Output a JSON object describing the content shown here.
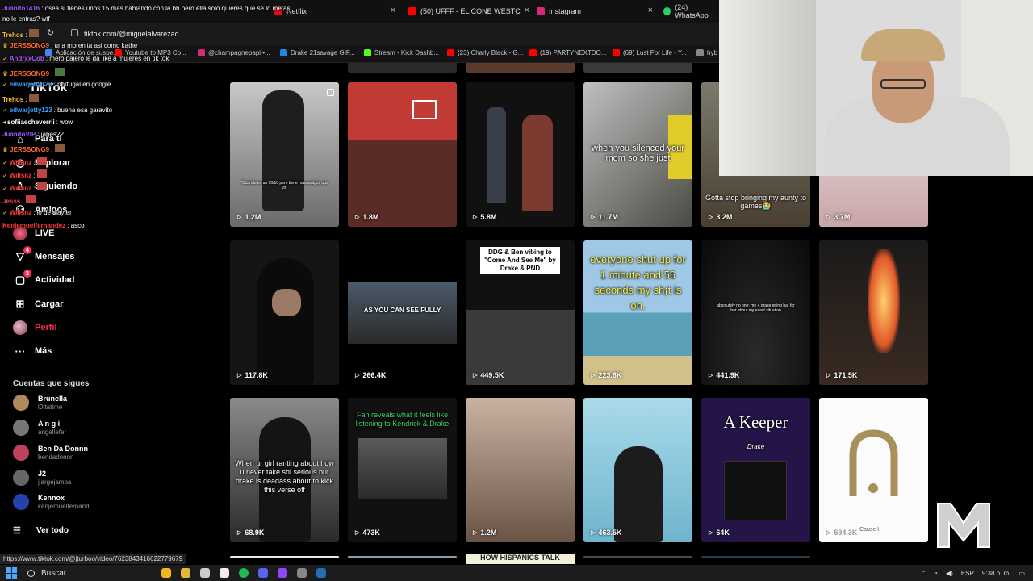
{
  "browser": {
    "tabs": [
      {
        "label": "Netflix",
        "icon": "netflix-icon",
        "color": "#e50914"
      },
      {
        "label": "(50) UFFF - EL CONE",
        "icon": "youtube-icon",
        "color": "#ff0000"
      },
      {
        "label": "WESTC",
        "icon": "youtube-icon",
        "color": "#ff0000"
      },
      {
        "label": "Instagram",
        "icon": "instagram-icon",
        "color": "#d62976"
      },
      {
        "label": "(24) WhatsApp",
        "icon": "whatsapp-icon",
        "color": "#25d366"
      }
    ],
    "url": "tiktok.com/@miguelalvarezac",
    "bookmarks": [
      {
        "label": "Aplicación de suspe...",
        "color": "#4285f4"
      },
      {
        "label": "Youtube to MP3 Co...",
        "color": "#ff0000"
      },
      {
        "label": "@champagnepapi •...",
        "color": "#d62976"
      },
      {
        "label": "Drake 21savage GIF...",
        "color": "#1e88e5"
      },
      {
        "label": "Stream - Kick Dashb...",
        "color": "#53fc18"
      },
      {
        "label": "(23) Charly Black - G...",
        "color": "#ff0000"
      },
      {
        "label": "(19) PARTYNEXTDO...",
        "color": "#ff0000"
      },
      {
        "label": "(69) Lust For Life - Y...",
        "color": "#ff0000"
      },
      {
        "label": "hyb",
        "color": "#888888"
      }
    ]
  },
  "sidebar": {
    "logo": "TikTok",
    "nav": [
      {
        "label": "Para ti",
        "icon": "home-icon"
      },
      {
        "label": "Explorar",
        "icon": "compass-icon"
      },
      {
        "label": "Siguiendo",
        "icon": "following-icon"
      },
      {
        "label": "Amigos",
        "icon": "friends-icon"
      },
      {
        "label": "LIVE",
        "icon": "live-icon"
      },
      {
        "label": "Mensajes",
        "icon": "messages-icon",
        "badge": "4"
      },
      {
        "label": "Actividad",
        "icon": "activity-icon",
        "badge": "2"
      },
      {
        "label": "Cargar",
        "icon": "upload-icon"
      },
      {
        "label": "Perfil",
        "icon": "profile-icon"
      },
      {
        "label": "Más",
        "icon": "more-icon"
      }
    ],
    "following_title": "Cuentas que sigues",
    "following": [
      {
        "name": "Brunella",
        "handle": "l0ttatime",
        "color": "#b08a5a"
      },
      {
        "name": "A n g i",
        "handle": "angellefer",
        "color": "#777777"
      },
      {
        "name": "Ben Da Donnn",
        "handle": "bendadonnn",
        "color": "#c04060"
      },
      {
        "name": "J2",
        "handle": "jlargejamba",
        "color": "#666666"
      },
      {
        "name": "Kennox",
        "handle": "kenjemuelfernand",
        "color": "#2244aa"
      }
    ],
    "see_all": "Ver todo"
  },
  "chat": [
    {
      "user": "Juanito1416",
      "color": "#9b59ff",
      "text": "osea si tienes unos 15 días hablando con la bb pero ella solo quieres que se lo metas",
      "cont": "no le entras? wtf"
    },
    {
      "user": "Trehos",
      "color": "#f4c430",
      "text": ""
    },
    {
      "user": "JERSSONG9",
      "color": "#ff6a2a",
      "text": "una morenita asi como kathe"
    },
    {
      "user": "AndrxxCob",
      "color": "#b05cff",
      "text": "mero pajero le da like a mujeres en tik tok"
    },
    {
      "user": "JERSSONG9",
      "color": "#ff6a2a",
      "text": ""
    },
    {
      "user": "edwarjetty123",
      "color": "#3aa0ff",
      "text": "portugal en google"
    },
    {
      "user": "Trehos",
      "color": "#f4c430",
      "text": ""
    },
    {
      "user": "edwarjetty123",
      "color": "#3aa0ff",
      "text": "buena esa garavito"
    },
    {
      "user": "sofiiaecheverrii",
      "color": "#ffffff",
      "text": "wow"
    },
    {
      "user": "JuanitoVIP",
      "color": "#9b59ff",
      "text": "jabes??"
    },
    {
      "user": "JERSSONG9",
      "color": "#ff6a2a",
      "text": ""
    },
    {
      "user": "Willsnz",
      "color": "#ff3b3b",
      "text": ""
    },
    {
      "user": "Willsnz",
      "color": "#ff3b3b",
      "text": ""
    },
    {
      "user": "Willsnz",
      "color": "#ff3b3b",
      "text": ""
    },
    {
      "user": "Jesss",
      "color": "#ff3b3b",
      "text": ""
    },
    {
      "user": "Willsnz",
      "color": "#ff3b3b",
      "text": "lo de slayter"
    },
    {
      "user": "Kenjemuelfernandez",
      "color": "#ff3b3b",
      "text": "asco"
    }
  ],
  "grid": [
    {
      "views": "1.2M",
      "caption": "\"Cuando es un 10/10 pero tiene más amigos que yo\"",
      "bg": "#9a9a9a"
    },
    {
      "views": "1.8M",
      "caption": "",
      "bg": "#b3342f"
    },
    {
      "views": "5.8M",
      "caption": "",
      "bg": "#1b1b1b"
    },
    {
      "views": "11.7M",
      "caption": "when you silenced your mom so she just",
      "bg": "#8a8a80"
    },
    {
      "views": "3.2M",
      "caption": "Gotta stop bringing my aunty to games😭",
      "bg": "#6a6252"
    },
    {
      "views": "3.7M",
      "caption": "",
      "bg": "#d8c2c4"
    },
    {
      "views": "117.8K",
      "caption": "",
      "bg": "#161616"
    },
    {
      "views": "266.4K",
      "caption": "AS YOU CAN SEE FULLY",
      "bg": "#0a0a0a"
    },
    {
      "views": "449.5K",
      "caption": "DDG & Ben vibing to \"Come And See Me\" by Drake & PND",
      "bg": "#2a2a2a"
    },
    {
      "views": "223.6K",
      "caption": "everyone shut up for 1 minute and 56 seconds my sh¡t is on.",
      "bg": "#6fa7c8"
    },
    {
      "views": "441.9K",
      "caption": "absolutely no one: me + drake going bar for bar about my exact situation",
      "bg": "#141414"
    },
    {
      "views": "171.5K",
      "caption": "",
      "bg": "#3a2a1c"
    },
    {
      "views": "68.9K",
      "caption": "When ur girl ranting about how u never take shi serious but drake is deadass about to kick this verse off",
      "bg": "#4a4a4a"
    },
    {
      "views": "473K",
      "caption": "Fan reveals what it feels like listening to Kendrick & Drake",
      "bg": "#111111"
    },
    {
      "views": "1.2M",
      "caption": "",
      "bg": "#9a7e6c"
    },
    {
      "views": "463.5K",
      "caption": "",
      "bg": "#8fc4d8"
    },
    {
      "views": "64K",
      "caption": "A Keeper",
      "sub": "Drake",
      "bg": "#241447"
    },
    {
      "views": "594.3K",
      "caption": "Cause I",
      "bg": "#fbfbfb"
    }
  ],
  "grid_partial_caption": "HOW HISPANICS TALK",
  "status_url": "https://www.tiktok.com/@jturboo/video/7623843416622779679",
  "taskbar": {
    "search": "Buscar",
    "lang": "ESP",
    "time": "9:38 p. m."
  }
}
